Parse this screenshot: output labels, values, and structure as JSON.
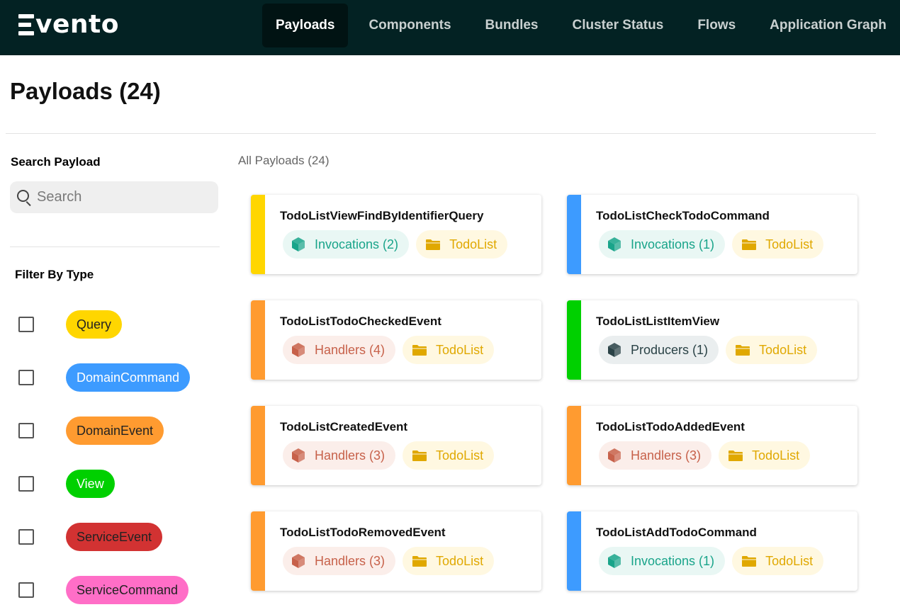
{
  "app": {
    "logo_text": "vento",
    "logo_alt": "Evento"
  },
  "nav": {
    "items": [
      {
        "label": "Payloads",
        "active": true
      },
      {
        "label": "Components",
        "active": false
      },
      {
        "label": "Bundles",
        "active": false
      },
      {
        "label": "Cluster Status",
        "active": false
      },
      {
        "label": "Flows",
        "active": false
      },
      {
        "label": "Application Graph",
        "active": false
      }
    ]
  },
  "page": {
    "title": "Payloads (24)"
  },
  "sidebar": {
    "search_label": "Search Payload",
    "search_placeholder": "Search",
    "search_value": "",
    "filter_label": "Filter By Type",
    "filters": [
      {
        "label": "Query",
        "bg": "#ffd600",
        "fg": "#222222",
        "checked": false
      },
      {
        "label": "DomainCommand",
        "bg": "#3d9bff",
        "fg": "#ffffff",
        "checked": false
      },
      {
        "label": "DomainEvent",
        "bg": "#ff9b30",
        "fg": "#222222",
        "checked": false
      },
      {
        "label": "View",
        "bg": "#00d000",
        "fg": "#ffffff",
        "checked": false
      },
      {
        "label": "ServiceEvent",
        "bg": "#d23232",
        "fg": "#222222",
        "checked": false
      },
      {
        "label": "ServiceCommand",
        "bg": "#ff6ec7",
        "fg": "#222222",
        "checked": false
      }
    ]
  },
  "main": {
    "list_label": "All Payloads (24)",
    "cards": [
      {
        "title": "TodoListViewFindByIdentifierQuery",
        "color": "#ffd600",
        "tag": {
          "kind": "invocations",
          "icon": "cube-icon",
          "label": "Invocations (2)"
        },
        "context": {
          "icon": "folder-icon",
          "label": "TodoList"
        }
      },
      {
        "title": "TodoListCheckTodoCommand",
        "color": "#3d9bff",
        "tag": {
          "kind": "invocations",
          "icon": "cube-icon",
          "label": "Invocations (1)"
        },
        "context": {
          "icon": "folder-icon",
          "label": "TodoList"
        }
      },
      {
        "title": "TodoListTodoCheckedEvent",
        "color": "#ff9b30",
        "tag": {
          "kind": "handlers",
          "icon": "cube-icon",
          "label": "Handlers (4)"
        },
        "context": {
          "icon": "folder-icon",
          "label": "TodoList"
        }
      },
      {
        "title": "TodoListListItemView",
        "color": "#00d000",
        "tag": {
          "kind": "producers",
          "icon": "cube-icon",
          "label": "Producers (1)"
        },
        "context": {
          "icon": "folder-icon",
          "label": "TodoList"
        }
      },
      {
        "title": "TodoListCreatedEvent",
        "color": "#ff9b30",
        "tag": {
          "kind": "handlers",
          "icon": "cube-icon",
          "label": "Handlers (3)"
        },
        "context": {
          "icon": "folder-icon",
          "label": "TodoList"
        }
      },
      {
        "title": "TodoListTodoAddedEvent",
        "color": "#ff9b30",
        "tag": {
          "kind": "handlers",
          "icon": "cube-icon",
          "label": "Handlers (3)"
        },
        "context": {
          "icon": "folder-icon",
          "label": "TodoList"
        }
      },
      {
        "title": "TodoListTodoRemovedEvent",
        "color": "#ff9b30",
        "tag": {
          "kind": "handlers",
          "icon": "cube-icon",
          "label": "Handlers (3)"
        },
        "context": {
          "icon": "folder-icon",
          "label": "TodoList"
        }
      },
      {
        "title": "TodoListAddTodoCommand",
        "color": "#3d9bff",
        "tag": {
          "kind": "invocations",
          "icon": "cube-icon",
          "label": "Invocations (1)"
        },
        "context": {
          "icon": "folder-icon",
          "label": "TodoList"
        }
      }
    ]
  },
  "colors": {
    "topbar": "#032223",
    "invocations_icon": "#19a48a",
    "handlers_icon": "#c7614a",
    "producers_icon": "#2a4246",
    "folder_icon": "#e0a800"
  }
}
